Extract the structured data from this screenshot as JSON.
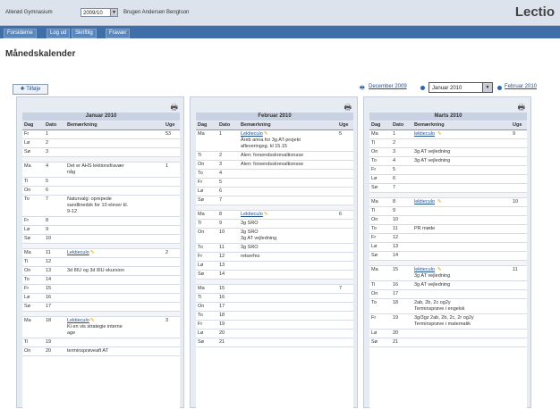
{
  "header": {
    "school_label": "Allerød Gymnasium",
    "year_value": "2009/10",
    "user_label": "Brugen Andersen Bengtson",
    "brand": "Lectio"
  },
  "nav": {
    "tabs": [
      "Forsiderne",
      "Log ud",
      "Skriftlig",
      "Fravær"
    ]
  },
  "page_title": "Månedskalender",
  "add_button": "Tilføje",
  "month_nav": {
    "prev": "December 2009",
    "selected": "Januar 2010",
    "next": "Februar 2010"
  },
  "icons": {
    "print": "printer-icon",
    "dropdown": "chevron-down-icon",
    "note": "note-icon"
  },
  "columns": [
    "Dag",
    "Dato",
    "Bemærkning",
    "Uge"
  ],
  "calendars": [
    {
      "title": "Januar 2010",
      "rows": [
        {
          "dag": "Fr",
          "dato": "1",
          "note": "",
          "link": "",
          "uge": "53"
        },
        {
          "dag": "Lø",
          "dato": "2",
          "note": "",
          "link": "",
          "uge": ""
        },
        {
          "dag": "Sø",
          "dato": "3",
          "note": "",
          "link": "",
          "uge": ""
        },
        {
          "sep": true
        },
        {
          "dag": "Ma",
          "dato": "4",
          "note": "Det er AHS lektionsfravær\nnåg",
          "link": "",
          "uge": "1"
        },
        {
          "dag": "Ti",
          "dato": "5",
          "note": "",
          "link": "",
          "uge": ""
        },
        {
          "dag": "On",
          "dato": "6",
          "note": "",
          "link": "",
          "uge": ""
        },
        {
          "dag": "To",
          "dato": "7",
          "note": "Naturvalg: oprepede\nsandlinedsk for 10 elever kl.\n9-12",
          "link": "",
          "uge": ""
        },
        {
          "dag": "Fr",
          "dato": "8",
          "note": "",
          "link": "",
          "uge": ""
        },
        {
          "dag": "Lø",
          "dato": "9",
          "note": "",
          "link": "",
          "uge": ""
        },
        {
          "dag": "Sø",
          "dato": "10",
          "note": "",
          "link": "",
          "uge": ""
        },
        {
          "sep": true
        },
        {
          "dag": "Ma",
          "dato": "11",
          "note": "",
          "link": "Lektieculo",
          "uge": "2"
        },
        {
          "dag": "Ti",
          "dato": "12",
          "note": "",
          "link": "",
          "uge": ""
        },
        {
          "dag": "On",
          "dato": "13",
          "note": "3d 8IU og 3d 8IU ekursion",
          "link": "",
          "uge": ""
        },
        {
          "dag": "To",
          "dato": "14",
          "note": "",
          "link": "",
          "uge": ""
        },
        {
          "dag": "Fr",
          "dato": "15",
          "note": "",
          "link": "",
          "uge": ""
        },
        {
          "dag": "Lø",
          "dato": "16",
          "note": "",
          "link": "",
          "uge": ""
        },
        {
          "dag": "Sø",
          "dato": "17",
          "note": "",
          "link": "",
          "uge": ""
        },
        {
          "sep": true
        },
        {
          "dag": "Ma",
          "dato": "18",
          "note": "Ki en vis strategie interne\nage",
          "link": "Lektieculo",
          "uge": "3"
        },
        {
          "dag": "Ti",
          "dato": "19",
          "note": "",
          "link": "",
          "uge": ""
        },
        {
          "dag": "On",
          "dato": "20",
          "note": "terminsprøveaft AT",
          "link": "",
          "uge": ""
        }
      ]
    },
    {
      "title": "Februar 2010",
      "rows": [
        {
          "dag": "Ma",
          "dato": "1",
          "note": "Åreb anna for 3g AT-projekt\nafleveringsg. kl 15.15",
          "link": "Lektieculo",
          "uge": "5"
        },
        {
          "dag": "Ti",
          "dato": "2",
          "note": "Alen: forsendsskrevaltionsse",
          "link": "",
          "uge": ""
        },
        {
          "dag": "On",
          "dato": "3",
          "note": "Alen: forsendsskrevaltionsse",
          "link": "",
          "uge": ""
        },
        {
          "dag": "To",
          "dato": "4",
          "note": "",
          "link": "",
          "uge": ""
        },
        {
          "dag": "Fr",
          "dato": "5",
          "note": "",
          "link": "",
          "uge": ""
        },
        {
          "dag": "Lø",
          "dato": "6",
          "note": "",
          "link": "",
          "uge": ""
        },
        {
          "dag": "Sø",
          "dato": "7",
          "note": "",
          "link": "",
          "uge": ""
        },
        {
          "sep": true
        },
        {
          "dag": "Ma",
          "dato": "8",
          "note": "",
          "link": "Lektieculo",
          "uge": "6"
        },
        {
          "dag": "Ti",
          "dato": "9",
          "note": "3g SRO",
          "link": "",
          "uge": ""
        },
        {
          "dag": "On",
          "dato": "10",
          "note": "3g SRO\n3g AT vejledning",
          "link": "",
          "uge": ""
        },
        {
          "dag": "To",
          "dato": "11",
          "note": "3g SRO",
          "link": "",
          "uge": ""
        },
        {
          "dag": "Fr",
          "dato": "12",
          "note": "retserfes",
          "link": "",
          "uge": ""
        },
        {
          "dag": "Lø",
          "dato": "13",
          "note": "",
          "link": "",
          "uge": ""
        },
        {
          "dag": "Sø",
          "dato": "14",
          "note": "",
          "link": "",
          "uge": ""
        },
        {
          "sep": true
        },
        {
          "dag": "Ma",
          "dato": "15",
          "note": "",
          "link": "",
          "uge": "7"
        },
        {
          "dag": "Ti",
          "dato": "16",
          "note": "",
          "link": "",
          "uge": ""
        },
        {
          "dag": "On",
          "dato": "17",
          "note": "",
          "link": "",
          "uge": ""
        },
        {
          "dag": "To",
          "dato": "18",
          "note": "",
          "link": "",
          "uge": ""
        },
        {
          "dag": "Fr",
          "dato": "19",
          "note": "",
          "link": "",
          "uge": ""
        },
        {
          "dag": "Lø",
          "dato": "20",
          "note": "",
          "link": "",
          "uge": ""
        },
        {
          "dag": "Sø",
          "dato": "21",
          "note": "",
          "link": "",
          "uge": ""
        }
      ]
    },
    {
      "title": "Marts 2010",
      "rows": [
        {
          "dag": "Ma",
          "dato": "1",
          "note": "",
          "link": "lektieculo",
          "uge": "9"
        },
        {
          "dag": "Ti",
          "dato": "2",
          "note": "",
          "link": "",
          "uge": ""
        },
        {
          "dag": "On",
          "dato": "3",
          "note": "3g AT vejledning",
          "link": "",
          "uge": ""
        },
        {
          "dag": "To",
          "dato": "4",
          "note": "3g AT vejledning",
          "link": "",
          "uge": ""
        },
        {
          "dag": "Fr",
          "dato": "5",
          "note": "",
          "link": "",
          "uge": ""
        },
        {
          "dag": "Lø",
          "dato": "6",
          "note": "",
          "link": "",
          "uge": ""
        },
        {
          "dag": "Sø",
          "dato": "7",
          "note": "",
          "link": "",
          "uge": ""
        },
        {
          "sep": true
        },
        {
          "dag": "Ma",
          "dato": "8",
          "note": "",
          "link": "lektieculo",
          "uge": "10"
        },
        {
          "dag": "Ti",
          "dato": "9",
          "note": "",
          "link": "",
          "uge": ""
        },
        {
          "dag": "On",
          "dato": "10",
          "note": "",
          "link": "",
          "uge": ""
        },
        {
          "dag": "To",
          "dato": "11",
          "note": "PR møde",
          "link": "",
          "uge": ""
        },
        {
          "dag": "Fr",
          "dato": "12",
          "note": "",
          "link": "",
          "uge": ""
        },
        {
          "dag": "Lø",
          "dato": "13",
          "note": "",
          "link": "",
          "uge": ""
        },
        {
          "dag": "Sø",
          "dato": "14",
          "note": "",
          "link": "",
          "uge": ""
        },
        {
          "sep": true
        },
        {
          "dag": "Ma",
          "dato": "15",
          "note": "3g AT vejledning",
          "link": "lektieculo",
          "uge": "11"
        },
        {
          "dag": "Ti",
          "dato": "16",
          "note": "3g AT vejledning",
          "link": "",
          "uge": ""
        },
        {
          "dag": "On",
          "dato": "17",
          "note": "",
          "link": "",
          "uge": ""
        },
        {
          "dag": "To",
          "dato": "18",
          "note": "2ab, 2b, 2c og2y\nTerminsprøve i engelsk",
          "link": "",
          "uge": ""
        },
        {
          "dag": "Fr",
          "dato": "19",
          "note": "3g/3gz 2ab, 2b, 2c, 2r og2y\nTerminsprøve i matematik",
          "link": "",
          "uge": ""
        },
        {
          "dag": "Lø",
          "dato": "20",
          "note": "",
          "link": "",
          "uge": ""
        },
        {
          "dag": "Sø",
          "dato": "21",
          "note": "",
          "link": "",
          "uge": ""
        }
      ]
    }
  ]
}
